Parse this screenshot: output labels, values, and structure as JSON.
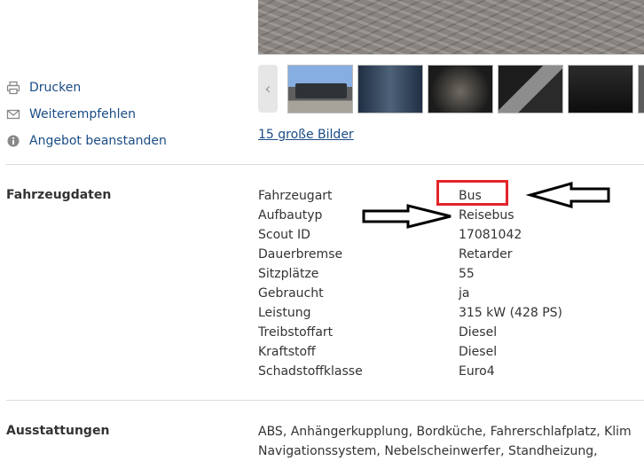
{
  "actions": [
    {
      "label": "Drucken",
      "icon": "printer-icon"
    },
    {
      "label": "Weiterempfehlen",
      "icon": "envelope-icon"
    },
    {
      "label": "Angebot beanstanden",
      "icon": "info-icon"
    }
  ],
  "gallery": {
    "prev_symbol": "‹",
    "big_images_link": "15 große Bilder"
  },
  "vehicle_data": {
    "section_title": "Fahrzeugdaten",
    "rows": [
      {
        "label": "Fahrzeugart",
        "value": "Bus"
      },
      {
        "label": "Aufbautyp",
        "value": "Reisebus"
      },
      {
        "label": "Scout ID",
        "value": "17081042"
      },
      {
        "label": "Dauerbremse",
        "value": "Retarder"
      },
      {
        "label": "Sitzplätze",
        "value": "55"
      },
      {
        "label": "Gebraucht",
        "value": "ja"
      },
      {
        "label": "Leistung",
        "value": "315 kW (428 PS)"
      },
      {
        "label": "Treibstoffart",
        "value": "Diesel"
      },
      {
        "label": "Kraftstoff",
        "value": "Diesel"
      },
      {
        "label": "Schadstoffklasse",
        "value": "Euro4"
      }
    ]
  },
  "equipment": {
    "section_title": "Ausstattungen",
    "line1": "ABS, Anhängerkupplung, Bordküche, Fahrerschlafplatz, Klim",
    "line2": "Navigationssystem, Nebelscheinwerfer, Standheizung,"
  },
  "colors": {
    "link": "#1a4c86",
    "text": "#333333",
    "annotation_box": "#e3242b",
    "annotation_arrow": "#000000"
  }
}
